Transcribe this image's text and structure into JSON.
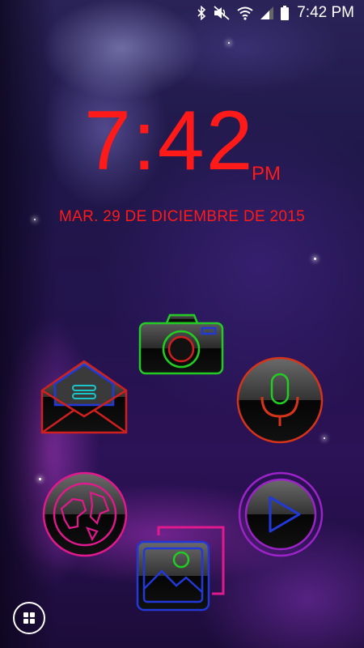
{
  "status_bar": {
    "time": "7:42 PM",
    "icons": [
      "bluetooth-icon",
      "mute-icon",
      "wifi-icon",
      "signal-icon",
      "battery-icon"
    ]
  },
  "lock_clock": {
    "time": "7:42",
    "ampm": "PM",
    "date": "MAR. 29 DE DICIEMBRE DE 2015",
    "color": "#ff1a1a"
  },
  "apps": [
    {
      "name": "camera",
      "icon": "camera-icon",
      "accent": "#22cc22"
    },
    {
      "name": "email",
      "icon": "envelope-icon",
      "accent": "#d01f1f"
    },
    {
      "name": "voice",
      "icon": "microphone-icon",
      "accent": "#d6341a"
    },
    {
      "name": "browser",
      "icon": "globe-icon",
      "accent": "#e0198c"
    },
    {
      "name": "music",
      "icon": "play-icon",
      "accent": "#9b23c8"
    },
    {
      "name": "gallery",
      "icon": "gallery-icon",
      "accent": "#2238d8"
    }
  ],
  "dock": {
    "icon": "apps-grid-icon"
  }
}
